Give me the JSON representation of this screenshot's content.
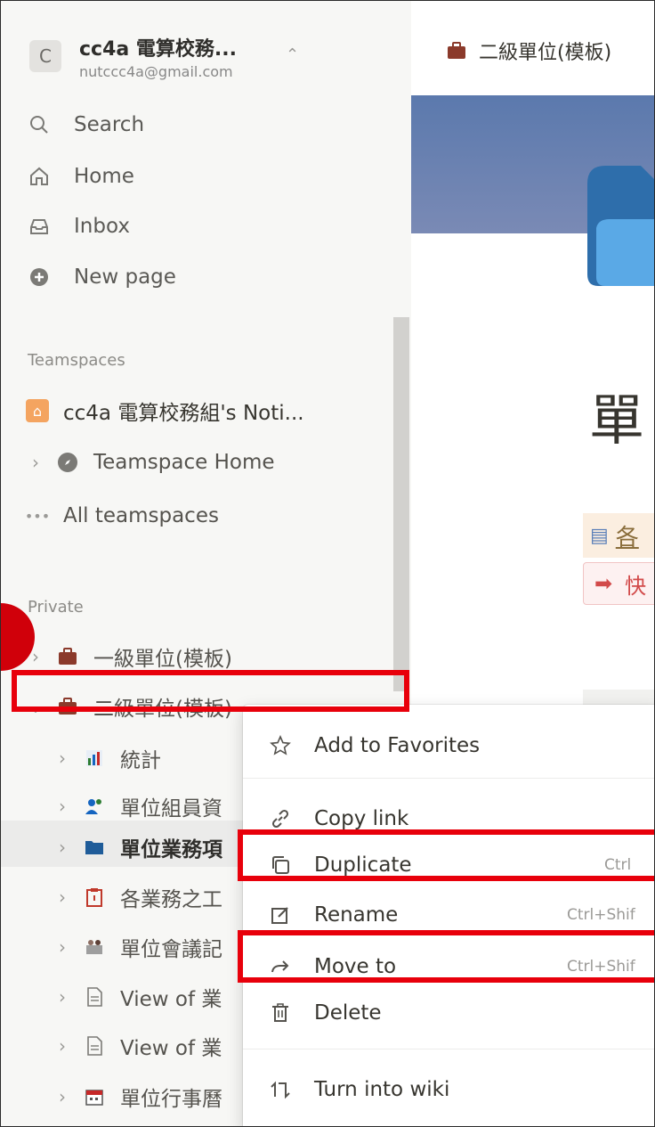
{
  "workspace": {
    "initial": "C",
    "name": "cc4a 電算校務...",
    "email": "nutccc4a@gmail.com"
  },
  "nav": {
    "search": "Search",
    "home": "Home",
    "inbox": "Inbox",
    "new_page": "New page"
  },
  "teamspaces": {
    "label": "Teamspaces",
    "workspace_page": "cc4a 電算校務組's Noti...",
    "teamspace_home": "Teamspace Home",
    "all_teamspaces": "All teamspaces"
  },
  "private": {
    "label": "Private",
    "items": [
      {
        "label": "一級單位(模板)"
      },
      {
        "label": "二級單位(模板)"
      },
      {
        "label": "統計"
      },
      {
        "label": "單位組員資"
      },
      {
        "label": "單位業務項"
      },
      {
        "label": "各業務之工"
      },
      {
        "label": "單位會議記"
      },
      {
        "label": "View of 業"
      },
      {
        "label": "View of 業"
      },
      {
        "label": "單位行事曆"
      }
    ]
  },
  "main": {
    "breadcrumb": "二級單位(模板)",
    "title": "單",
    "block1_text": "各",
    "block2_text": "快"
  },
  "context_menu": {
    "add_to_favorites": "Add to Favorites",
    "copy_link": "Copy link",
    "duplicate": "Duplicate",
    "duplicate_shortcut": "Ctrl",
    "rename": "Rename",
    "rename_shortcut": "Ctrl+Shif",
    "move_to": "Move to",
    "move_to_shortcut": "Ctrl+Shif",
    "delete": "Delete",
    "turn_into_wiki": "Turn into wiki"
  },
  "colors": {
    "annotation_red": "#e8000b",
    "sidebar_bg": "#f7f7f5",
    "cover_blue": "#5b79ad"
  }
}
